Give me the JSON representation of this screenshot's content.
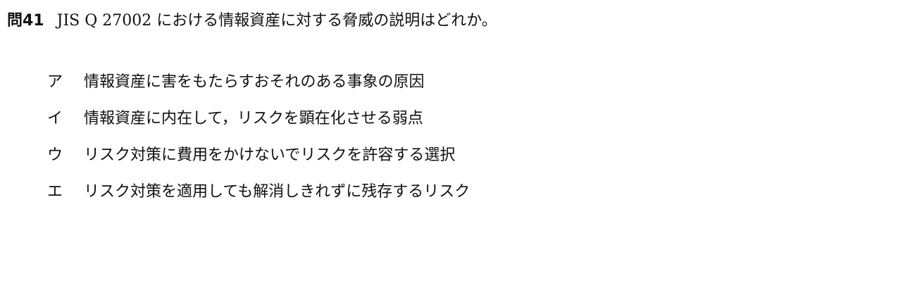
{
  "question": {
    "number": "問41",
    "text": "JIS Q 27002 における情報資産に対する脅威の説明はどれか。"
  },
  "choices": [
    {
      "label": "ア",
      "text": "情報資産に害をもたらすおそれのある事象の原因"
    },
    {
      "label": "イ",
      "text": "情報資産に内在して，リスクを顕在化させる弱点"
    },
    {
      "label": "ウ",
      "text": "リスク対策に費用をかけないでリスクを許容する選択"
    },
    {
      "label": "エ",
      "text": "リスク対策を適用しても解消しきれずに残存するリスク"
    }
  ]
}
